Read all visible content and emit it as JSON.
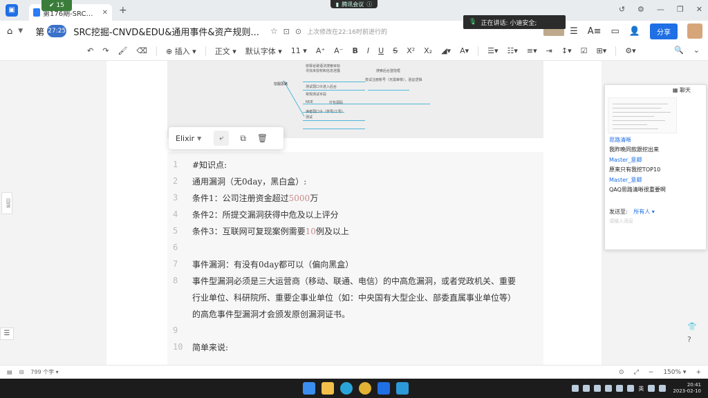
{
  "tabbar": {
    "tab_title": "第176期-SRC挖掘-CNV...",
    "recording_badge": "15",
    "meeting_label": "腾讯会议"
  },
  "docbar": {
    "prefix": "第",
    "timer": "27:25",
    "title": "SRC挖掘-CNVD&EDU&通用事件&资产规则...",
    "saved": "上次修改在22:16时前进行的",
    "speaking": "正在讲话: 小迪安全;",
    "share": "分享"
  },
  "toolbar": {
    "insert": "插入",
    "style": "正文",
    "font": "默认字体",
    "size": "11"
  },
  "mindmap": {
    "root": "挖掘思路",
    "n1": "依靠谷歌语法搜索目标",
    "n1b": "寻找未授权和信息泄露",
    "n2": "搜索后台登陆框",
    "n3": "测试弱口令进入后台",
    "n3b": "尝试注册账号（无需审核），验证逻辑",
    "n4": "常规测试手段",
    "n5": "NDE",
    "n5b": "打包源码",
    "n6": "读者弱口令（学号/工号）",
    "n6b": "测试"
  },
  "code_popup": {
    "language": "Elixir"
  },
  "code_lines": [
    {
      "no": "1",
      "text": "#知识点:"
    },
    {
      "no": "2",
      "text": "通用漏洞（无0day，黑白盒）:"
    },
    {
      "no": "3",
      "pre": "条件1：公司注册资金超过",
      "num": "5000",
      "post": "万"
    },
    {
      "no": "4",
      "text": "条件2：所提交漏洞获得中危及以上评分"
    },
    {
      "no": "5",
      "pre": "条件3：互联网可复现案例需要",
      "num": "10",
      "post": "例及以上"
    },
    {
      "no": "6",
      "text": ""
    },
    {
      "no": "7",
      "text": "事件漏洞：有没有0day都可以（偏向黑盒）"
    },
    {
      "no": "8",
      "text": "事件型漏洞必须是三大运营商（移动、联通、电信）的中高危漏洞，或者党政机关、重要"
    },
    {
      "no": "",
      "text": "行业单位、科研院所、重要企事业单位（如：中央国有大型企业、部委直属事业单位等）"
    },
    {
      "no": "",
      "text": "的高危事件型漏洞才会颁发原创漏洞证书。"
    },
    {
      "no": "9",
      "text": ""
    },
    {
      "no": "10",
      "text": "简单来说:"
    }
  ],
  "left": {
    "toc": "目录"
  },
  "chat": {
    "title": "聊天",
    "messages": [
      {
        "name": "思路清晰",
        "text": "我昨晚同款跟挖出来"
      },
      {
        "name": "Master_意卿",
        "text": "原来只有我挖TOP10"
      },
      {
        "name": "Master_意卿",
        "text": "QAQ思路清晰很重要啊"
      }
    ],
    "send_to_label": "发送至:",
    "send_to": "所有人",
    "input_placeholder": "请输入消息"
  },
  "status": {
    "word_count": "799 个字",
    "zoom": "150%"
  },
  "taskbar": {
    "ime": "英",
    "time": "20:41",
    "date": "2023-02-10"
  }
}
